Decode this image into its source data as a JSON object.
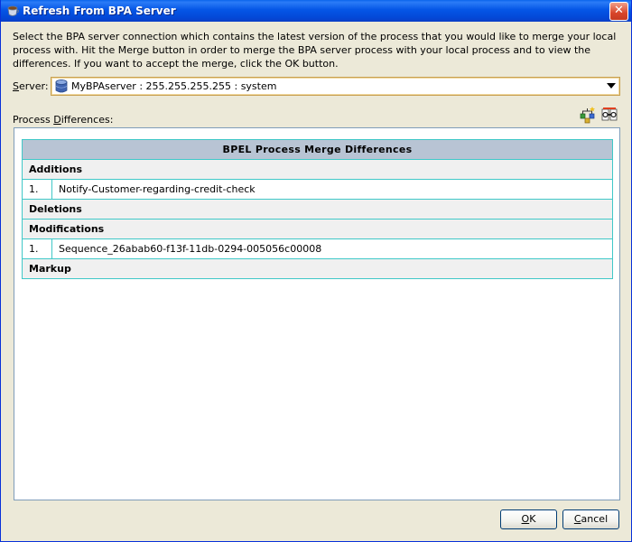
{
  "window": {
    "title": "Refresh From BPA Server",
    "close_symbol": "✕"
  },
  "instructions": "Select the BPA server connection which contains the latest version of the process that you would like to merge your local process with. Hit the Merge button in order to merge the BPA server process with your local process and to view the differences. If you want to accept the merge, click the OK button.",
  "server": {
    "label_mnemonic": "S",
    "label_rest": "erver:",
    "value": "MyBPAserver : 255.255.255.255 : system"
  },
  "differences": {
    "label_pre": "Process ",
    "label_mnemonic": "D",
    "label_post": "ifferences:",
    "table_title": "BPEL Process Merge Differences",
    "sections": {
      "additions": {
        "label": "Additions",
        "items": [
          {
            "num": "1.",
            "text": "Notify-Customer-regarding-credit-check"
          }
        ]
      },
      "deletions": {
        "label": "Deletions"
      },
      "modifications": {
        "label": "Modifications",
        "items": [
          {
            "num": "1.",
            "text": "Sequence_26abab60-f13f-11db-0294-005056c00008"
          }
        ]
      },
      "markup": {
        "label": "Markup"
      }
    }
  },
  "buttons": {
    "ok_mnemonic": "O",
    "ok_rest": "K",
    "cancel_pre": "",
    "cancel_mnemonic": "C",
    "cancel_rest": "ancel"
  },
  "icons": {
    "title": "app-cup-icon",
    "server": "database-icon",
    "merge": "merge-icon",
    "compare": "compare-icon"
  }
}
